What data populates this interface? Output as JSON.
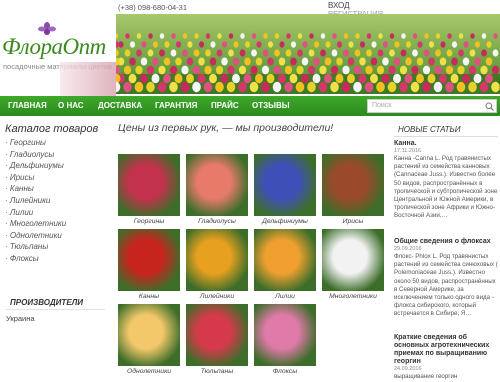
{
  "header": {
    "logo_text": "ФлораОпт",
    "logo_sub": "посадочные материалы цветов",
    "phone": "(+38) 098-680-04-31",
    "login": "ВХОД",
    "register": "РЕГИСТРАЦИЯ"
  },
  "nav": {
    "items": [
      "ГЛАВНАЯ",
      "О НАС",
      "ДОСТАВКА",
      "ГАРАНТИЯ",
      "ПРАЙС",
      "ОТЗЫВЫ"
    ],
    "search_placeholder": "Поиск"
  },
  "sidebar": {
    "catalog_title": "Каталог товаров",
    "categories": [
      "Георгины",
      "Гладиолусы",
      "Дельфиниумы",
      "Ирисы",
      "Канны",
      "Лилейники",
      "Лилии",
      "Многолетники",
      "Однолетники",
      "Тюльпаны",
      "Флоксы"
    ],
    "producers_title": "ПРОИЗВОДИТЕЛИ",
    "country": "Украина"
  },
  "main": {
    "slogan": "Цены из первых рук, — мы производители!",
    "products": [
      {
        "name": "Георгины",
        "color": "#c2324c"
      },
      {
        "name": "Гладиолусы",
        "color": "#e87a6a"
      },
      {
        "name": "Дельфиниумы",
        "color": "#3f4fb8"
      },
      {
        "name": "Ирисы",
        "color": "#9a4a2a"
      },
      {
        "name": "Канны",
        "color": "#c8241e"
      },
      {
        "name": "Лилейники",
        "color": "#e8a020"
      },
      {
        "name": "Лилии",
        "color": "#f0a030"
      },
      {
        "name": "Многолетники",
        "color": "#f2f2f2"
      },
      {
        "name": "Однолетники",
        "color": "#f3c86a"
      },
      {
        "name": "Тюльпаны",
        "color": "#d43a4a"
      },
      {
        "name": "Флоксы",
        "color": "#e07aa8"
      }
    ]
  },
  "news": {
    "title": "НОВЫЕ СТАТЬИ",
    "items": [
      {
        "head": "Канна.",
        "date": "17.11.2016",
        "body": "Канна -Canna L. Род травянистых растений из семейства канновых (Cannaceae Juss.). Известно более 50 видов, распространённых в тропической и субтропической зоне Центральной и Южной Америки, в тропической зоне Африки и Южно-Восточной Азии,…"
      },
      {
        "head": "Общие сведения о флоксах",
        "date": "29.09.2016",
        "body": "Флокс- Phlox L. Род травянистых растений из семейства синюховых ( Polemoniaceae Juss.). Известно около 50 видов, распространённых в Северной Америке, за исключением только одного вида - флокса сибирского, который встречается в Сибире, Я…"
      },
      {
        "head": "Краткие сведения об основных агротехнических приемах по выращиванию георгин",
        "date": "24.09.2016",
        "body": "выращивание георгин"
      }
    ]
  }
}
